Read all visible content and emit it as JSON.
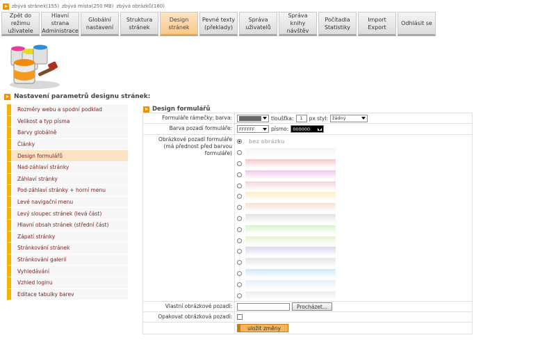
{
  "status": {
    "pages": "zbývá stránek(155)",
    "space": "zbývá místa(250 MB)",
    "images": "zbývá obrázků(180)"
  },
  "nav": {
    "tabs": [
      {
        "label": "Zpět do režimu\nuživatele"
      },
      {
        "label": "Hlavní strana\nAdministrace"
      },
      {
        "label": "Globální\nnastavení"
      },
      {
        "label": "Struktura\nstránek"
      },
      {
        "label": "Design\nstránek"
      },
      {
        "label": "Pevné texty\n(překlady)"
      },
      {
        "label": "Správa\nuživatelů"
      },
      {
        "label": "Správa\nknihy návštěv"
      },
      {
        "label": "Počítadla\nStatistiky"
      },
      {
        "label": "Import\nExport"
      },
      {
        "label": "Odhlásit se"
      }
    ],
    "active_index": 4
  },
  "section_title": "Nastavení parametrů designu stránek:",
  "sidebar": {
    "items": [
      {
        "label": "Rozměry webu a spodní podklad"
      },
      {
        "label": "Velikost a typ písma"
      },
      {
        "label": "Barvy globálně"
      },
      {
        "label": "Články"
      },
      {
        "label": "Design formulářů"
      },
      {
        "label": "Nad-záhlaví stránky"
      },
      {
        "label": "Záhlaví stránky"
      },
      {
        "label": "Pod-záhlaví stránky + horní menu"
      },
      {
        "label": "Levé navigační menu"
      },
      {
        "label": "Levý sloupec stránek (levá část)"
      },
      {
        "label": "Hlavní obsah stránek (střední část)"
      },
      {
        "label": "Zápatí stránky"
      },
      {
        "label": "Stránkování stránek"
      },
      {
        "label": "Stránkování galerií"
      },
      {
        "label": "Vyhledávání"
      },
      {
        "label": "Vzhled loginu"
      },
      {
        "label": "Editace tabulky barev"
      }
    ],
    "active_index": 4
  },
  "form": {
    "title": "Design formulářů",
    "frame_label": "Formuláře rámečky: barva:",
    "frame_color": "#666666",
    "thickness_label": "tloušťka:",
    "thickness_value": "1",
    "style_label": "px styl:",
    "style_value": "žádný",
    "bg_label": "Barva pozadí formuláře:",
    "bg_value": "FFFFFF",
    "font_label": "písmo:",
    "font_value": "000000",
    "image_label": "Obrázkové pozadí formuláře\n(má přednost před barvou formuláře)",
    "no_image": "bez obrázku",
    "swatches": [
      "#f4f4f4",
      "#f6c9c9",
      "#f3c8ea",
      "#f7d3d8",
      "#fbf0c8",
      "#f1e3d2",
      "#e2e2e2",
      "#d9f2cc",
      "#e4f4d4",
      "#ddd6ea",
      "#e6e6e6",
      "#cfe7f7",
      "#e3f1fb",
      "#ededed"
    ],
    "custom_label": "Vlastní obrázkové pozadí:",
    "browse_label": "Procházet...",
    "repeat_label": "Opakovat obrázková pozadí:",
    "save_label": "uložit změny"
  }
}
